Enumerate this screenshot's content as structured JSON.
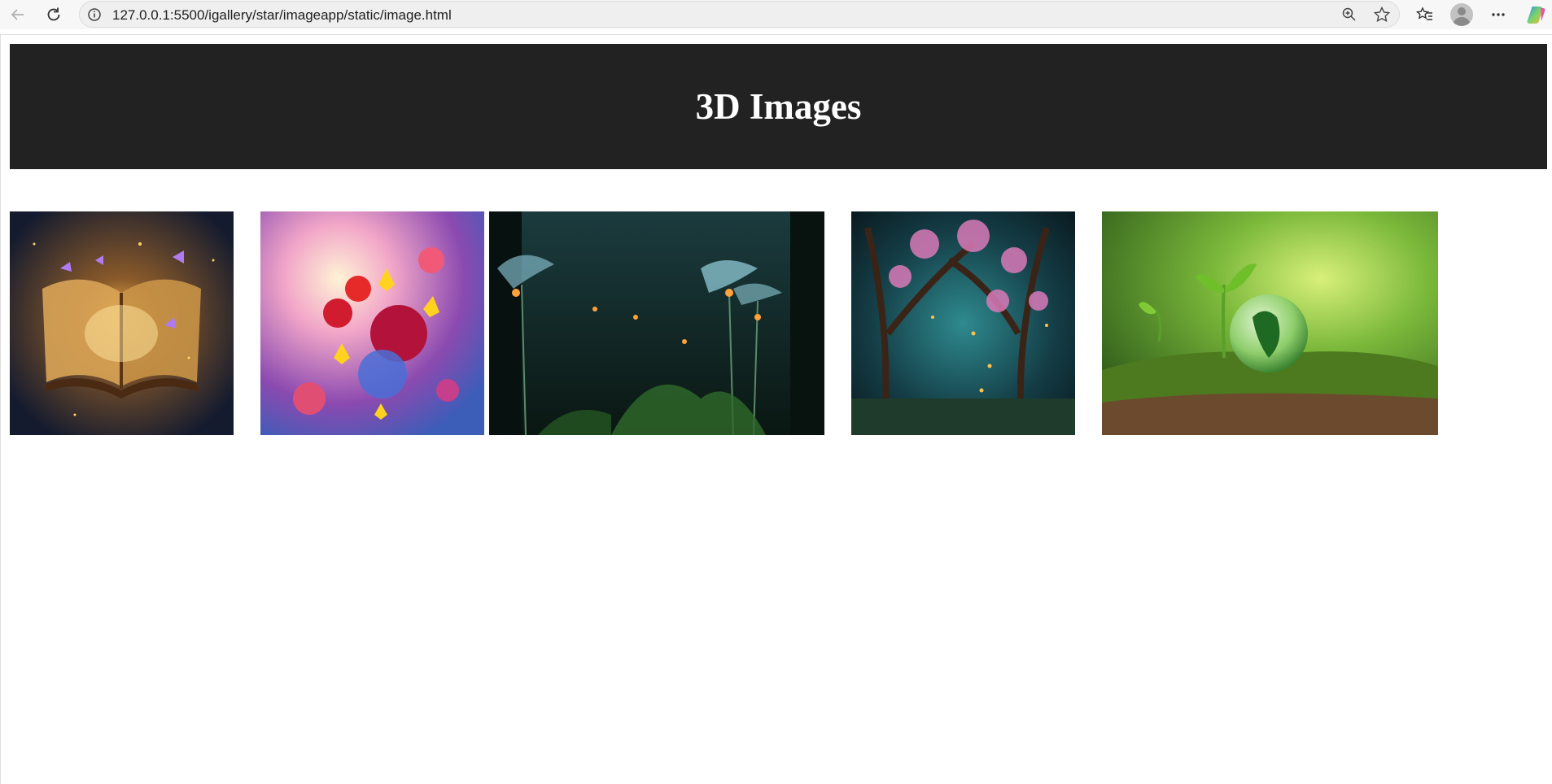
{
  "browser": {
    "url": "127.0.0.1:5500/igallery/star/imageapp/static/image.html",
    "icons": [
      "back-arrow-icon",
      "reload-icon",
      "info-icon",
      "zoom-icon",
      "star-icon",
      "favorites-icon",
      "profile-icon",
      "more-icon",
      "copilot-icon"
    ]
  },
  "page": {
    "title": "3D Images"
  },
  "gallery": {
    "images": [
      {
        "name": "book-butterflies-image",
        "subject": "glowing open book with purple butterflies"
      },
      {
        "name": "flower-bouquet-image",
        "subject": "colorful bouquet of tulips and daffodils"
      },
      {
        "name": "glowing-mushrooms-image",
        "subject": "luminous glowing flowers in dark forest"
      },
      {
        "name": "blossom-forest-image",
        "subject": "enchanted forest with pink blossoms and lights"
      },
      {
        "name": "earth-sprout-image",
        "subject": "glass globe with green sprout on moss"
      }
    ]
  },
  "colors": {
    "header_bg": "#222222",
    "header_text": "#ffffff",
    "page_bg": "#ffffff"
  }
}
